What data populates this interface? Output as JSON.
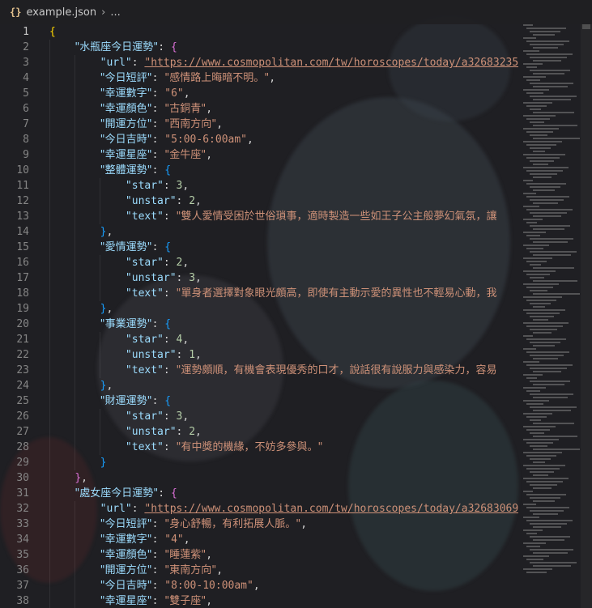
{
  "breadcrumb": {
    "icon": "{}",
    "file": "example.json",
    "sep": "›",
    "more": "..."
  },
  "line_numbers": [
    "1",
    "2",
    "3",
    "4",
    "5",
    "6",
    "7",
    "8",
    "9",
    "10",
    "11",
    "12",
    "13",
    "14",
    "15",
    "16",
    "17",
    "18",
    "19",
    "20",
    "21",
    "22",
    "23",
    "24",
    "25",
    "26",
    "27",
    "28",
    "29",
    "30",
    "31",
    "32",
    "33",
    "34",
    "35",
    "36",
    "37",
    "38"
  ],
  "active_line": 1,
  "code_lines": [
    [
      {
        "t": "{",
        "c": "b1"
      }
    ],
    [
      {
        "t": "    "
      },
      {
        "t": "\"水瓶座今日運勢\"",
        "c": "k cjk"
      },
      {
        "t": ": ",
        "c": "p"
      },
      {
        "t": "{",
        "c": "b2"
      }
    ],
    [
      {
        "t": "        "
      },
      {
        "t": "\"url\"",
        "c": "k"
      },
      {
        "t": ": ",
        "c": "p"
      },
      {
        "t": "\"https://www.cosmopolitan.com/tw/horoscopes/today/a32683235/",
        "c": "s u"
      }
    ],
    [
      {
        "t": "        "
      },
      {
        "t": "\"今日短評\"",
        "c": "k cjk"
      },
      {
        "t": ": ",
        "c": "p"
      },
      {
        "t": "\"感情路上晦暗不明。\"",
        "c": "s cjk"
      },
      {
        "t": ",",
        "c": "p"
      }
    ],
    [
      {
        "t": "        "
      },
      {
        "t": "\"幸運數字\"",
        "c": "k cjk"
      },
      {
        "t": ": ",
        "c": "p"
      },
      {
        "t": "\"6\"",
        "c": "s"
      },
      {
        "t": ",",
        "c": "p"
      }
    ],
    [
      {
        "t": "        "
      },
      {
        "t": "\"幸運顏色\"",
        "c": "k cjk"
      },
      {
        "t": ": ",
        "c": "p"
      },
      {
        "t": "\"古銅青\"",
        "c": "s cjk"
      },
      {
        "t": ",",
        "c": "p"
      }
    ],
    [
      {
        "t": "        "
      },
      {
        "t": "\"開運方位\"",
        "c": "k cjk"
      },
      {
        "t": ": ",
        "c": "p"
      },
      {
        "t": "\"西南方向\"",
        "c": "s cjk"
      },
      {
        "t": ",",
        "c": "p"
      }
    ],
    [
      {
        "t": "        "
      },
      {
        "t": "\"今日吉時\"",
        "c": "k cjk"
      },
      {
        "t": ": ",
        "c": "p"
      },
      {
        "t": "\"5:00-6:00am\"",
        "c": "s"
      },
      {
        "t": ",",
        "c": "p"
      }
    ],
    [
      {
        "t": "        "
      },
      {
        "t": "\"幸運星座\"",
        "c": "k cjk"
      },
      {
        "t": ": ",
        "c": "p"
      },
      {
        "t": "\"金牛座\"",
        "c": "s cjk"
      },
      {
        "t": ",",
        "c": "p"
      }
    ],
    [
      {
        "t": "        "
      },
      {
        "t": "\"整體運勢\"",
        "c": "k cjk"
      },
      {
        "t": ": ",
        "c": "p"
      },
      {
        "t": "{",
        "c": "b3"
      }
    ],
    [
      {
        "t": "            "
      },
      {
        "t": "\"star\"",
        "c": "k"
      },
      {
        "t": ": ",
        "c": "p"
      },
      {
        "t": "3",
        "c": "n"
      },
      {
        "t": ",",
        "c": "p"
      }
    ],
    [
      {
        "t": "            "
      },
      {
        "t": "\"unstar\"",
        "c": "k"
      },
      {
        "t": ": ",
        "c": "p"
      },
      {
        "t": "2",
        "c": "n"
      },
      {
        "t": ",",
        "c": "p"
      }
    ],
    [
      {
        "t": "            "
      },
      {
        "t": "\"text\"",
        "c": "k"
      },
      {
        "t": ": ",
        "c": "p"
      },
      {
        "t": "\"雙人愛情受困於世俗瑣事，適時製造一些如王子公主般夢幻氣氛，讓",
        "c": "s cjk"
      }
    ],
    [
      {
        "t": "        "
      },
      {
        "t": "}",
        "c": "b3"
      },
      {
        "t": ",",
        "c": "p"
      }
    ],
    [
      {
        "t": "        "
      },
      {
        "t": "\"愛情運勢\"",
        "c": "k cjk"
      },
      {
        "t": ": ",
        "c": "p"
      },
      {
        "t": "{",
        "c": "b3"
      }
    ],
    [
      {
        "t": "            "
      },
      {
        "t": "\"star\"",
        "c": "k"
      },
      {
        "t": ": ",
        "c": "p"
      },
      {
        "t": "2",
        "c": "n"
      },
      {
        "t": ",",
        "c": "p"
      }
    ],
    [
      {
        "t": "            "
      },
      {
        "t": "\"unstar\"",
        "c": "k"
      },
      {
        "t": ": ",
        "c": "p"
      },
      {
        "t": "3",
        "c": "n"
      },
      {
        "t": ",",
        "c": "p"
      }
    ],
    [
      {
        "t": "            "
      },
      {
        "t": "\"text\"",
        "c": "k"
      },
      {
        "t": ": ",
        "c": "p"
      },
      {
        "t": "\"單身者選擇對象眼光頗高，即使有主動示愛的異性也不輕易心動，我",
        "c": "s cjk"
      }
    ],
    [
      {
        "t": "        "
      },
      {
        "t": "}",
        "c": "b3"
      },
      {
        "t": ",",
        "c": "p"
      }
    ],
    [
      {
        "t": "        "
      },
      {
        "t": "\"事業運勢\"",
        "c": "k cjk"
      },
      {
        "t": ": ",
        "c": "p"
      },
      {
        "t": "{",
        "c": "b3"
      }
    ],
    [
      {
        "t": "            "
      },
      {
        "t": "\"star\"",
        "c": "k"
      },
      {
        "t": ": ",
        "c": "p"
      },
      {
        "t": "4",
        "c": "n"
      },
      {
        "t": ",",
        "c": "p"
      }
    ],
    [
      {
        "t": "            "
      },
      {
        "t": "\"unstar\"",
        "c": "k"
      },
      {
        "t": ": ",
        "c": "p"
      },
      {
        "t": "1",
        "c": "n"
      },
      {
        "t": ",",
        "c": "p"
      }
    ],
    [
      {
        "t": "            "
      },
      {
        "t": "\"text\"",
        "c": "k"
      },
      {
        "t": ": ",
        "c": "p"
      },
      {
        "t": "\"運勢頗順，有機會表現優秀的口才，說話很有說服力與感染力，容易",
        "c": "s cjk"
      }
    ],
    [
      {
        "t": "        "
      },
      {
        "t": "}",
        "c": "b3"
      },
      {
        "t": ",",
        "c": "p"
      }
    ],
    [
      {
        "t": "        "
      },
      {
        "t": "\"財運運勢\"",
        "c": "k cjk"
      },
      {
        "t": ": ",
        "c": "p"
      },
      {
        "t": "{",
        "c": "b3"
      }
    ],
    [
      {
        "t": "            "
      },
      {
        "t": "\"star\"",
        "c": "k"
      },
      {
        "t": ": ",
        "c": "p"
      },
      {
        "t": "3",
        "c": "n"
      },
      {
        "t": ",",
        "c": "p"
      }
    ],
    [
      {
        "t": "            "
      },
      {
        "t": "\"unstar\"",
        "c": "k"
      },
      {
        "t": ": ",
        "c": "p"
      },
      {
        "t": "2",
        "c": "n"
      },
      {
        "t": ",",
        "c": "p"
      }
    ],
    [
      {
        "t": "            "
      },
      {
        "t": "\"text\"",
        "c": "k"
      },
      {
        "t": ": ",
        "c": "p"
      },
      {
        "t": "\"有中獎的機緣，不妨多參與。\"",
        "c": "s cjk"
      }
    ],
    [
      {
        "t": "        "
      },
      {
        "t": "}",
        "c": "b3"
      }
    ],
    [
      {
        "t": "    "
      },
      {
        "t": "}",
        "c": "b2"
      },
      {
        "t": ",",
        "c": "p"
      }
    ],
    [
      {
        "t": "    "
      },
      {
        "t": "\"處女座今日運勢\"",
        "c": "k cjk"
      },
      {
        "t": ": ",
        "c": "p"
      },
      {
        "t": "{",
        "c": "b2"
      }
    ],
    [
      {
        "t": "        "
      },
      {
        "t": "\"url\"",
        "c": "k"
      },
      {
        "t": ": ",
        "c": "p"
      },
      {
        "t": "\"https://www.cosmopolitan.com/tw/horoscopes/today/a32683069/",
        "c": "s u"
      }
    ],
    [
      {
        "t": "        "
      },
      {
        "t": "\"今日短評\"",
        "c": "k cjk"
      },
      {
        "t": ": ",
        "c": "p"
      },
      {
        "t": "\"身心舒暢，有利拓展人脈。\"",
        "c": "s cjk"
      },
      {
        "t": ",",
        "c": "p"
      }
    ],
    [
      {
        "t": "        "
      },
      {
        "t": "\"幸運數字\"",
        "c": "k cjk"
      },
      {
        "t": ": ",
        "c": "p"
      },
      {
        "t": "\"4\"",
        "c": "s"
      },
      {
        "t": ",",
        "c": "p"
      }
    ],
    [
      {
        "t": "        "
      },
      {
        "t": "\"幸運顏色\"",
        "c": "k cjk"
      },
      {
        "t": ": ",
        "c": "p"
      },
      {
        "t": "\"睡蓮紫\"",
        "c": "s cjk"
      },
      {
        "t": ",",
        "c": "p"
      }
    ],
    [
      {
        "t": "        "
      },
      {
        "t": "\"開運方位\"",
        "c": "k cjk"
      },
      {
        "t": ": ",
        "c": "p"
      },
      {
        "t": "\"東南方向\"",
        "c": "s cjk"
      },
      {
        "t": ",",
        "c": "p"
      }
    ],
    [
      {
        "t": "        "
      },
      {
        "t": "\"今日吉時\"",
        "c": "k cjk"
      },
      {
        "t": ": ",
        "c": "p"
      },
      {
        "t": "\"8:00-10:00am\"",
        "c": "s"
      },
      {
        "t": ",",
        "c": "p"
      }
    ],
    [
      {
        "t": "        "
      },
      {
        "t": "\"幸運星座\"",
        "c": "k cjk"
      },
      {
        "t": ": ",
        "c": "p"
      },
      {
        "t": "\"雙子座\"",
        "c": "s cjk"
      },
      {
        "t": ",",
        "c": "p"
      }
    ]
  ],
  "colors": {
    "key": "#9cdcfe",
    "string": "#ce9178",
    "number": "#b5cea8",
    "bracket_1": "#ffd700",
    "bracket_2": "#da70d6",
    "bracket_3": "#179fff",
    "line_number": "#858585",
    "background": "#1f1f23"
  }
}
